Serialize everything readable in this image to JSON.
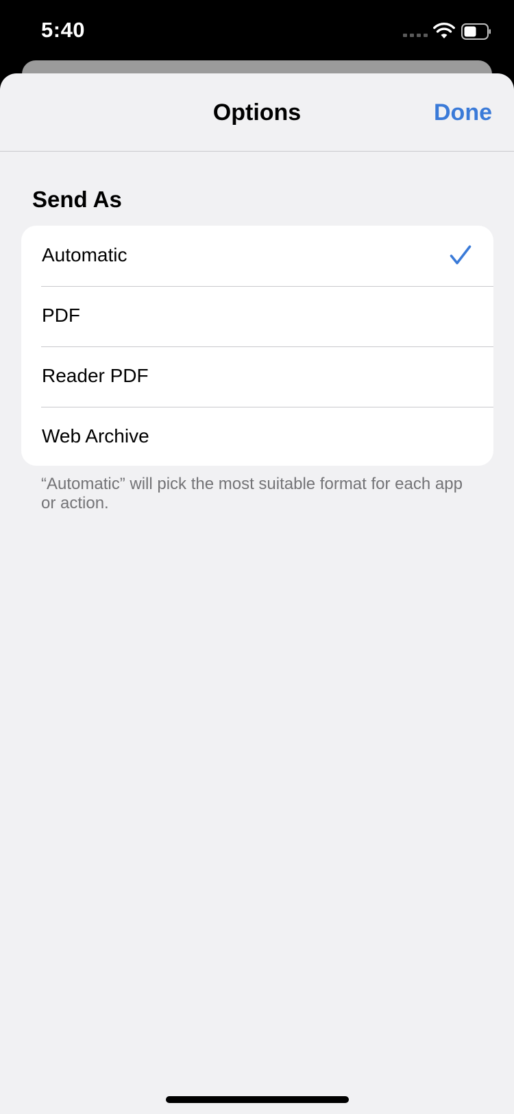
{
  "status_bar": {
    "time": "5:40"
  },
  "nav": {
    "title": "Options",
    "done_label": "Done"
  },
  "section": {
    "header": "Send As",
    "options": [
      {
        "label": "Automatic",
        "selected": true
      },
      {
        "label": "PDF",
        "selected": false
      },
      {
        "label": "Reader PDF",
        "selected": false
      },
      {
        "label": "Web Archive",
        "selected": false
      }
    ],
    "footer": "“Automatic” will pick the most suitable format for each app or action."
  },
  "colors": {
    "accent": "#3a7ad8",
    "sheet_background": "#f1f1f3",
    "secondary_text": "#737376"
  },
  "icons": {
    "checkmark": "checkmark-icon",
    "wifi": "wifi-icon",
    "battery": "battery-icon",
    "signal": "cellular-signal-icon"
  }
}
